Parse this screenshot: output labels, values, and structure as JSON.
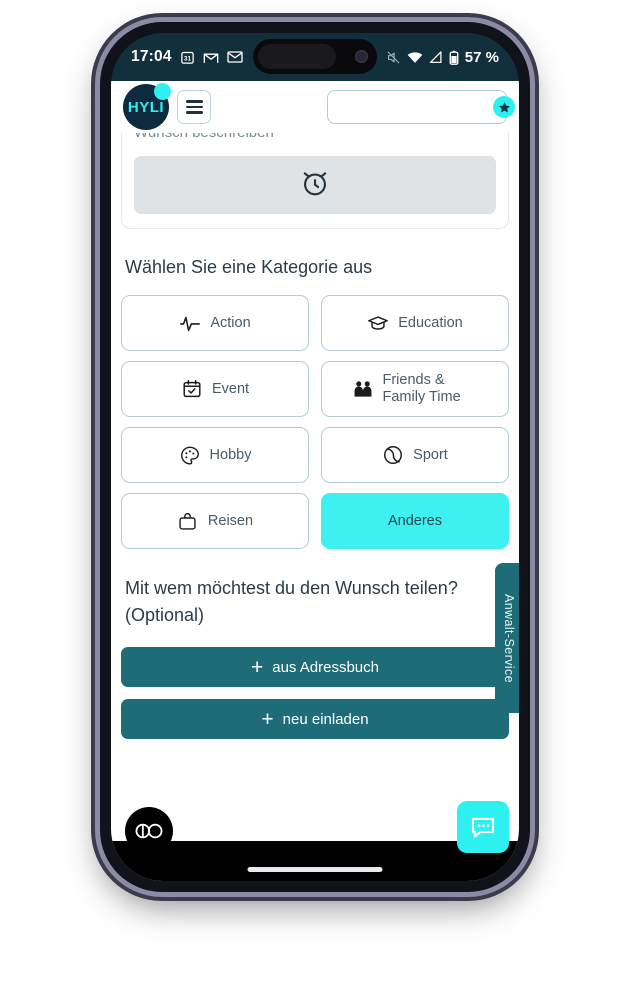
{
  "status_bar": {
    "time": "17:04",
    "battery_text": "57 %",
    "left_icons": [
      "calendar-31-icon",
      "gmail-icon",
      "mail-icon"
    ],
    "right_icons": [
      "mute-icon",
      "wifi-icon",
      "cellular-signal-icon",
      "battery-icon"
    ]
  },
  "header": {
    "logo_text": "HYLI",
    "menu_icon": "hamburger-menu-icon",
    "search_value": "",
    "search_placeholder": "",
    "star_icon": "star-icon"
  },
  "top_field": {
    "label": "Wunsch beschreiben",
    "alarm_icon": "alarm-clock-icon"
  },
  "category_section": {
    "title": "Wählen Sie eine Kategorie aus",
    "items": [
      {
        "label": "Action",
        "icon": "activity-pulse-icon",
        "selected": false,
        "two_line": false
      },
      {
        "label": "Education",
        "icon": "graduation-cap-icon",
        "selected": false,
        "two_line": false
      },
      {
        "label": "Event",
        "icon": "calendar-check-icon",
        "selected": false,
        "two_line": false
      },
      {
        "label": "Friends & Family Time",
        "icon": "people-group-icon",
        "selected": false,
        "two_line": true
      },
      {
        "label": "Hobby",
        "icon": "palette-icon",
        "selected": false,
        "two_line": false
      },
      {
        "label": "Sport",
        "icon": "ball-icon",
        "selected": false,
        "two_line": false
      },
      {
        "label": "Reisen",
        "icon": "suitcase-icon",
        "selected": false,
        "two_line": false
      },
      {
        "label": "Anderes",
        "icon": "",
        "selected": true,
        "two_line": false
      }
    ]
  },
  "share_section": {
    "title": "Mit wem möchtest du den Wunsch teilen? (Optional)",
    "buttons": [
      {
        "label": "aus Adressbuch",
        "icon": "plus-icon"
      },
      {
        "label": "neu einladen",
        "icon": "plus-icon"
      }
    ]
  },
  "side_tab": {
    "label": "Anwalt-Service"
  },
  "widgets": {
    "cookie_badge_icon": "cookie-consent-toggle-icon",
    "chat_icon": "chat-bubble-icon"
  },
  "colors": {
    "accent_cyan": "#2ef0f0",
    "teal_dark": "#1d6c77",
    "navy": "#0e2a3f",
    "status_bar": "#12303c",
    "card_border": "#b6cdd2"
  }
}
